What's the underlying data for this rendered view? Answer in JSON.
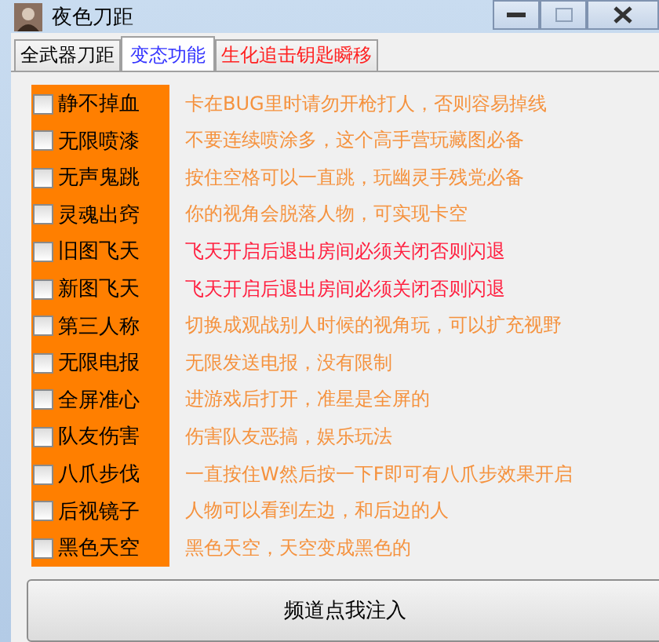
{
  "window": {
    "title": "夜色刀距"
  },
  "tabs": [
    {
      "label": "全武器刀距",
      "selected": false,
      "color": "#000000"
    },
    {
      "label": "变态功能",
      "selected": true,
      "color": "#3333ff"
    },
    {
      "label": "生化追击钥匙瞬移",
      "selected": false,
      "color": "#ff2020"
    }
  ],
  "features": [
    {
      "label": "静不掉血",
      "checked": false,
      "description": "卡在BUG里时请勿开枪打人，否则容易掉线",
      "color": "#f5923e"
    },
    {
      "label": "无限喷漆",
      "checked": false,
      "description": "不要连续喷涂多，这个高手营玩藏图必备",
      "color": "#f5923e"
    },
    {
      "label": "无声鬼跳",
      "checked": false,
      "description": "按住空格可以一直跳，玩幽灵手残党必备",
      "color": "#f5923e"
    },
    {
      "label": "灵魂出窍",
      "checked": false,
      "description": "你的视角会脱落人物，可实现卡空",
      "color": "#f5923e"
    },
    {
      "label": "旧图飞天",
      "checked": false,
      "description": "飞天开启后退出房间必须关闭否则闪退",
      "color": "#ff2040"
    },
    {
      "label": "新图飞天",
      "checked": false,
      "description": "飞天开启后退出房间必须关闭否则闪退",
      "color": "#ff2040"
    },
    {
      "label": "第三人称",
      "checked": false,
      "description": "切换成观战别人时候的视角玩，可以扩充视野",
      "color": "#f5923e"
    },
    {
      "label": "无限电报",
      "checked": false,
      "description": "无限发送电报，没有限制",
      "color": "#f5923e"
    },
    {
      "label": "全屏准心",
      "checked": false,
      "description": "进游戏后打开，准星是全屏的",
      "color": "#f5923e"
    },
    {
      "label": "队友伤害",
      "checked": false,
      "description": "伤害队友恶搞，娱乐玩法",
      "color": "#f5923e"
    },
    {
      "label": "八爪步伐",
      "checked": false,
      "description": "一直按住W然后按一下F即可有八爪步效果开启",
      "color": "#f5923e"
    },
    {
      "label": "后视镜子",
      "checked": false,
      "description": "人物可以看到左边，和后边的人",
      "color": "#f5923e"
    },
    {
      "label": "黑色天空",
      "checked": false,
      "description": "黑色天空，天空变成黑色的",
      "color": "#f5923e"
    }
  ],
  "inject_button": "频道点我注入"
}
